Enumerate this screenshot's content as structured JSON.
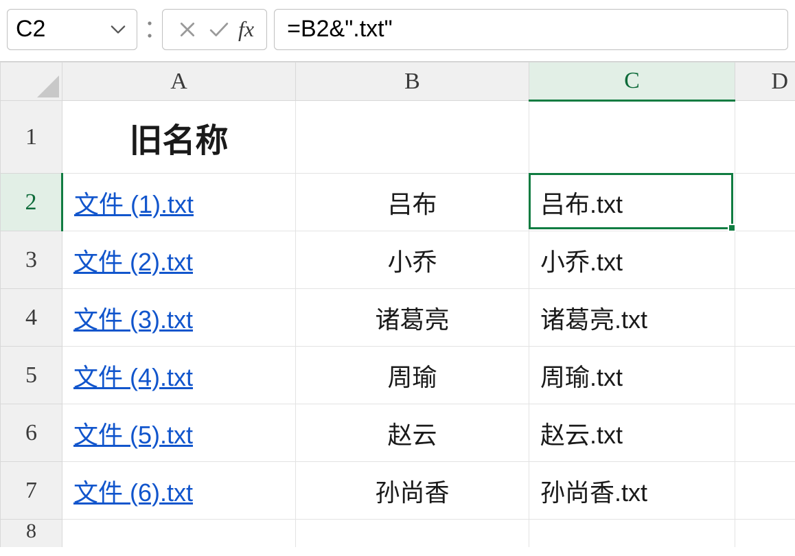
{
  "formula_bar": {
    "name_box": "C2",
    "formula": "=B2&\".txt\"",
    "fx_label": "fx"
  },
  "columns": {
    "A": "A",
    "B": "B",
    "C": "C",
    "D": "D"
  },
  "rows": {
    "1": "1",
    "2": "2",
    "3": "3",
    "4": "4",
    "5": "5",
    "6": "6",
    "7": "7",
    "8": "8"
  },
  "header": {
    "A1": "旧名称"
  },
  "data": [
    {
      "A": "文件 (1).txt",
      "B": "吕布",
      "C": "吕布.txt"
    },
    {
      "A": "文件 (2).txt",
      "B": "小乔",
      "C": "小乔.txt"
    },
    {
      "A": "文件 (3).txt",
      "B": "诸葛亮",
      "C": "诸葛亮.txt"
    },
    {
      "A": "文件 (4).txt",
      "B": "周瑜",
      "C": "周瑜.txt"
    },
    {
      "A": "文件 (5).txt",
      "B": "赵云",
      "C": "赵云.txt"
    },
    {
      "A": "文件 (6).txt",
      "B": "孙尚香",
      "C": "孙尚香.txt"
    }
  ],
  "selection": {
    "cell": "C2"
  },
  "colors": {
    "accent": "#107c41",
    "link": "#1155cc"
  }
}
